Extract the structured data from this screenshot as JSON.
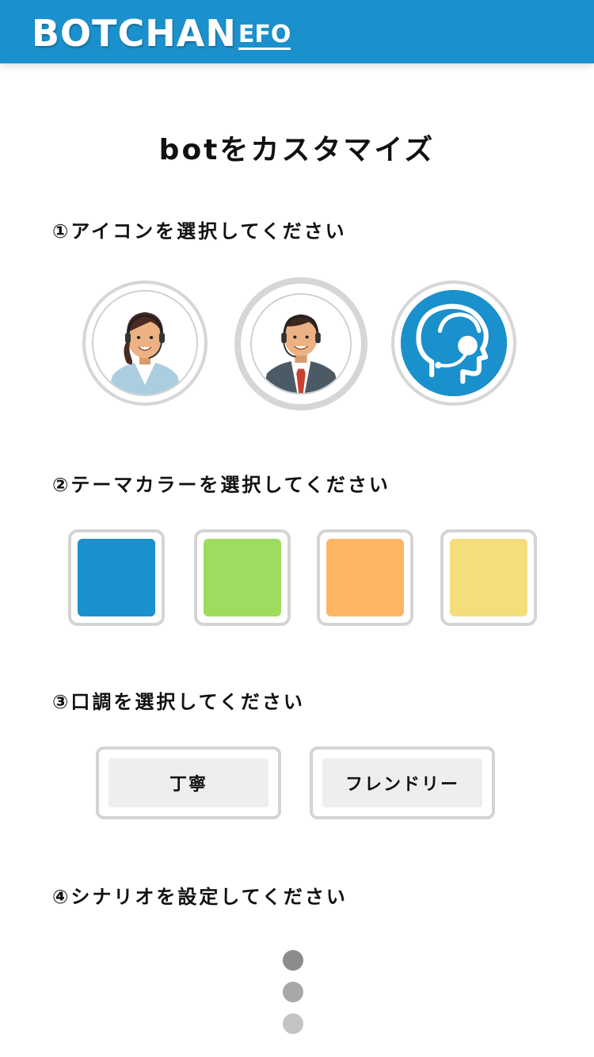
{
  "header": {
    "logo_main": "BOTCHAN",
    "logo_sub": "EFO",
    "bg_color": "#1a90cc"
  },
  "page_title": "botをカスタマイズ",
  "sections": {
    "icon": {
      "label": "①アイコンを選択してください",
      "options": [
        {
          "name": "female-operator-icon",
          "selected": false
        },
        {
          "name": "male-operator-icon",
          "selected": true
        },
        {
          "name": "headset-head-icon",
          "selected": false
        }
      ]
    },
    "theme": {
      "label": "②テーマカラーを選択してください",
      "colors": [
        "#1a90cc",
        "#9edc5f",
        "#feb664",
        "#f6dd7c"
      ]
    },
    "tone": {
      "label": "③口調を選択してください",
      "options": [
        "丁寧",
        "フレンドリー"
      ]
    },
    "scenario": {
      "label": "④シナリオを設定してください"
    }
  },
  "loading_dots": [
    "#8c8c8c",
    "#a8a8a8",
    "#c4c4c4"
  ]
}
